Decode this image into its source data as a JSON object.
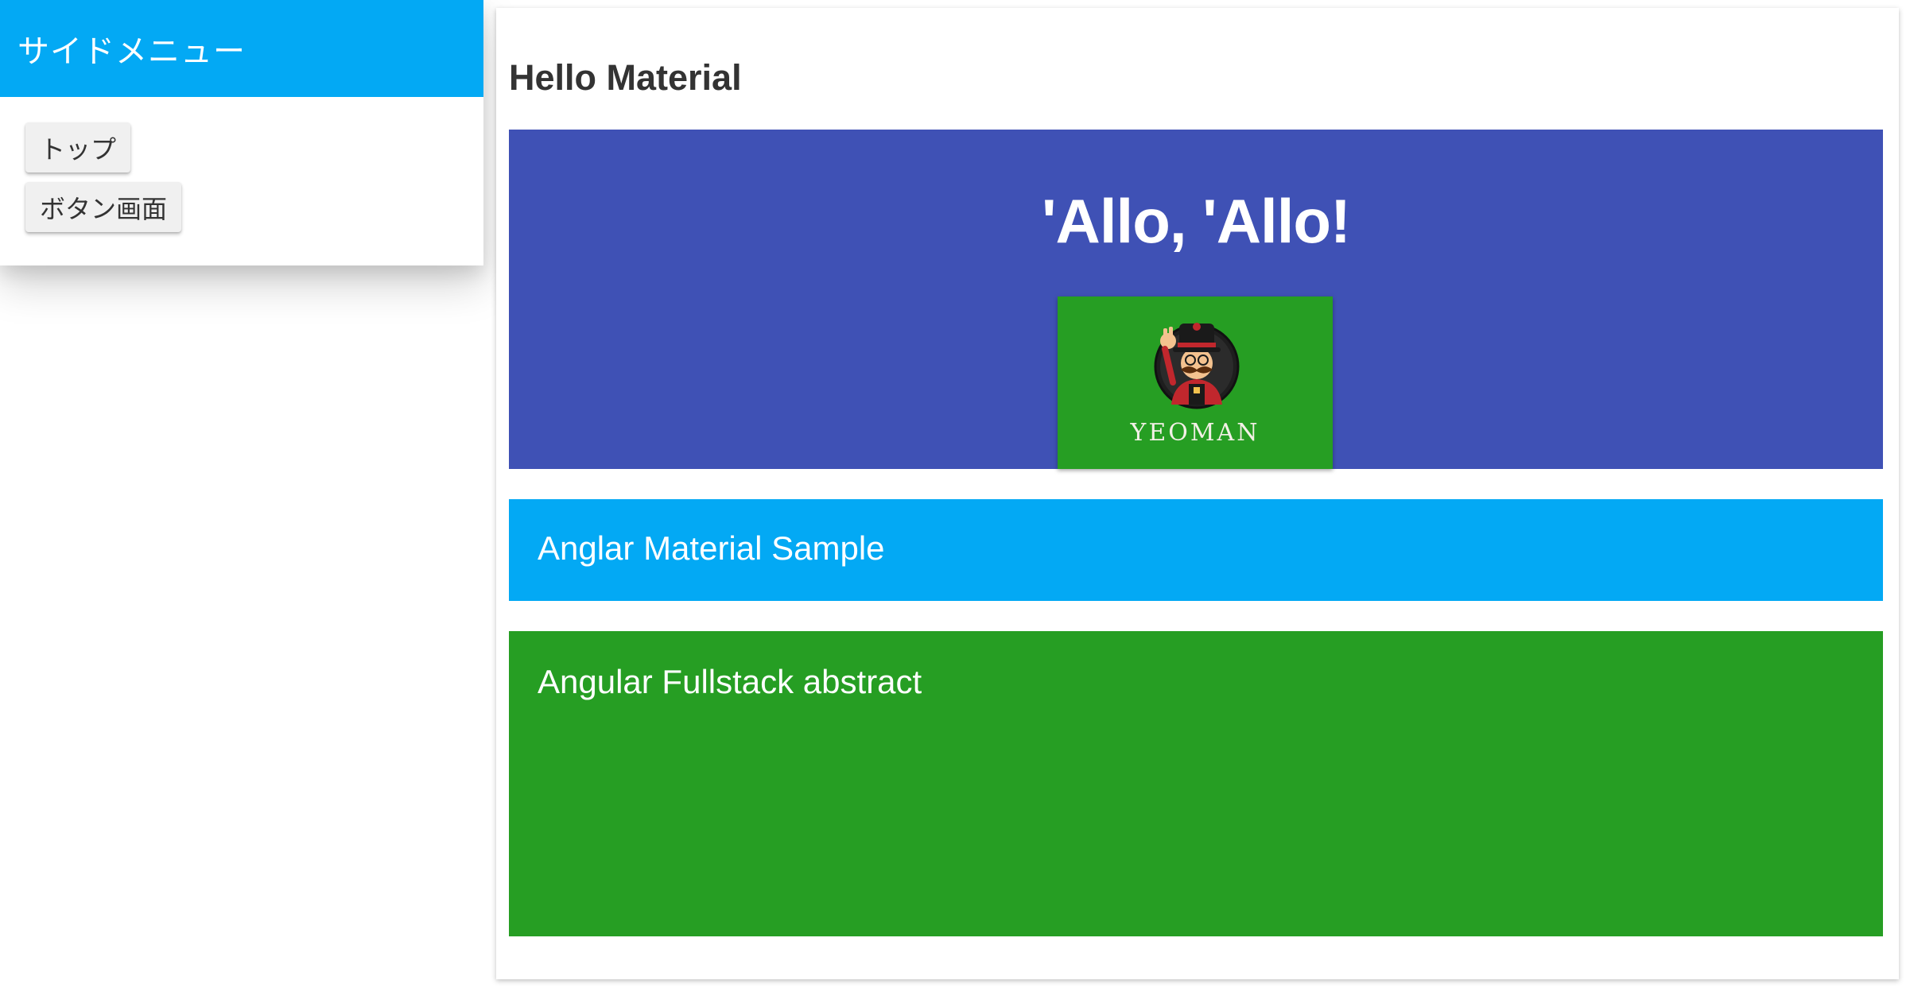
{
  "sidebar": {
    "title": "サイドメニュー",
    "items": [
      {
        "label": "トップ"
      },
      {
        "label": "ボタン画面"
      }
    ]
  },
  "main": {
    "title": "Hello Material",
    "hero": {
      "heading": "'Allo, 'Allo!",
      "logo_text": "YEOMAN",
      "logo_icon": "yeoman-mascot-icon"
    },
    "cards": [
      {
        "text": "Anglar Material Sample"
      },
      {
        "text": "Angular Fullstack abstract"
      }
    ]
  },
  "colors": {
    "sidebar_header": "#03a9f4",
    "hero_background": "#3f51b5",
    "card_blue": "#03a9f4",
    "card_green": "#269e23"
  }
}
